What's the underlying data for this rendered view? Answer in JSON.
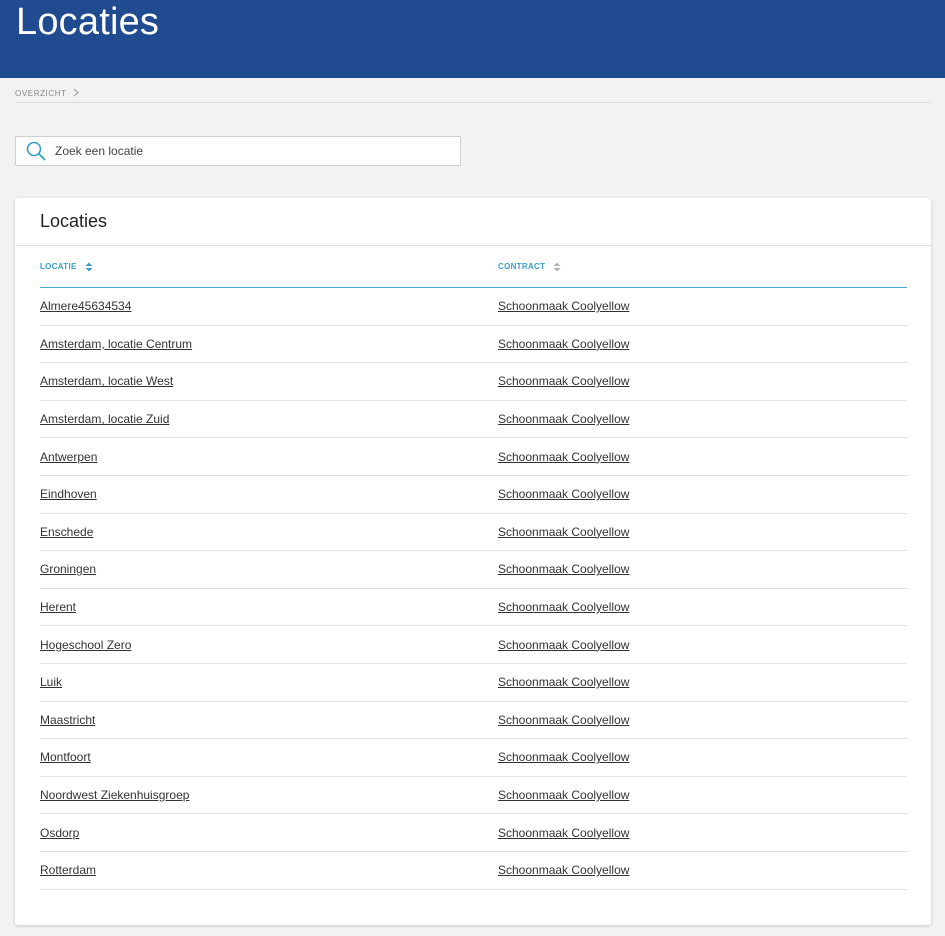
{
  "header": {
    "title": "Locaties"
  },
  "breadcrumb": {
    "items": [
      "OVERZICHT"
    ]
  },
  "search": {
    "placeholder": "Zoek een locatie",
    "value": ""
  },
  "card": {
    "title": "Locaties",
    "columns": {
      "locatie": "LOCATIE",
      "contract": "CONTRACT"
    },
    "sort": {
      "column": "LOCATIE",
      "direction": "ascending"
    },
    "rows": [
      {
        "locatie": "Almere45634534",
        "contract": "Schoonmaak Coolyellow"
      },
      {
        "locatie": "Amsterdam, locatie Centrum",
        "contract": "Schoonmaak Coolyellow"
      },
      {
        "locatie": "Amsterdam, locatie West",
        "contract": "Schoonmaak Coolyellow"
      },
      {
        "locatie": "Amsterdam, locatie Zuid",
        "contract": "Schoonmaak Coolyellow"
      },
      {
        "locatie": "Antwerpen",
        "contract": "Schoonmaak Coolyellow"
      },
      {
        "locatie": "Eindhoven",
        "contract": "Schoonmaak Coolyellow"
      },
      {
        "locatie": "Enschede",
        "contract": "Schoonmaak Coolyellow"
      },
      {
        "locatie": "Groningen",
        "contract": "Schoonmaak Coolyellow"
      },
      {
        "locatie": "Herent",
        "contract": "Schoonmaak Coolyellow"
      },
      {
        "locatie": "Hogeschool Zero",
        "contract": "Schoonmaak Coolyellow"
      },
      {
        "locatie": "Luik",
        "contract": "Schoonmaak Coolyellow"
      },
      {
        "locatie": "Maastricht",
        "contract": "Schoonmaak Coolyellow"
      },
      {
        "locatie": "Montfoort",
        "contract": "Schoonmaak Coolyellow"
      },
      {
        "locatie": "Noordwest Ziekenhuisgroep",
        "contract": "Schoonmaak Coolyellow"
      },
      {
        "locatie": "Osdorp",
        "contract": "Schoonmaak Coolyellow"
      },
      {
        "locatie": "Rotterdam",
        "contract": "Schoonmaak Coolyellow"
      }
    ]
  },
  "theme": {
    "header_bg": "#214b90",
    "accent": "#3a9ec9",
    "page_bg": "#f2f2f2"
  },
  "icons": {
    "search": "search-icon",
    "breadcrumb_separator": "chevron-right-icon",
    "sort_active": "sort-icon",
    "sort_inactive": "sort-icon"
  }
}
